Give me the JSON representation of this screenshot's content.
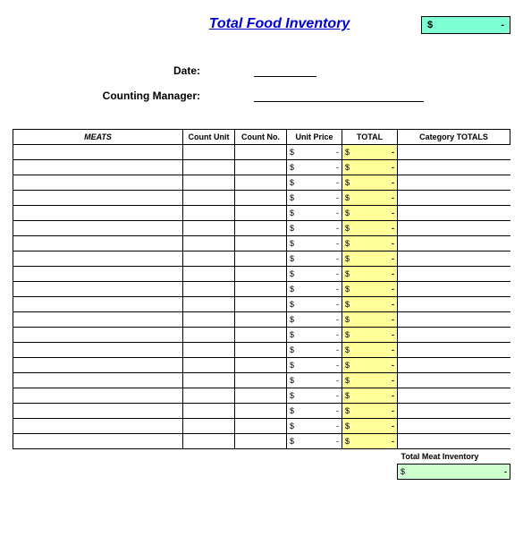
{
  "title": "Total Food Inventory",
  "grand_total": {
    "currency": "$",
    "value": "-"
  },
  "form": {
    "date_label": "Date:",
    "manager_label": "Counting Manager:"
  },
  "headers": {
    "category": "MEATS",
    "count_unit": "Count Unit",
    "count_no": "Count No.",
    "unit_price": "Unit Price",
    "total": "TOTAL",
    "cat_totals": "Category TOTALS"
  },
  "rows": [
    {
      "unit_price": {
        "c": "$",
        "v": "-"
      },
      "total": {
        "c": "$",
        "v": "-"
      }
    },
    {
      "unit_price": {
        "c": "$",
        "v": "-"
      },
      "total": {
        "c": "$",
        "v": "-"
      }
    },
    {
      "unit_price": {
        "c": "$",
        "v": "-"
      },
      "total": {
        "c": "$",
        "v": "-"
      }
    },
    {
      "unit_price": {
        "c": "$",
        "v": "-"
      },
      "total": {
        "c": "$",
        "v": "-"
      }
    },
    {
      "unit_price": {
        "c": "$",
        "v": "-"
      },
      "total": {
        "c": "$",
        "v": "-"
      }
    },
    {
      "unit_price": {
        "c": "$",
        "v": "-"
      },
      "total": {
        "c": "$",
        "v": "-"
      }
    },
    {
      "unit_price": {
        "c": "$",
        "v": "-"
      },
      "total": {
        "c": "$",
        "v": "-"
      }
    },
    {
      "unit_price": {
        "c": "$",
        "v": "-"
      },
      "total": {
        "c": "$",
        "v": "-"
      }
    },
    {
      "unit_price": {
        "c": "$",
        "v": "-"
      },
      "total": {
        "c": "$",
        "v": "-"
      }
    },
    {
      "unit_price": {
        "c": "$",
        "v": "-"
      },
      "total": {
        "c": "$",
        "v": "-"
      }
    },
    {
      "unit_price": {
        "c": "$",
        "v": "-"
      },
      "total": {
        "c": "$",
        "v": "-"
      }
    },
    {
      "unit_price": {
        "c": "$",
        "v": "-"
      },
      "total": {
        "c": "$",
        "v": "-"
      }
    },
    {
      "unit_price": {
        "c": "$",
        "v": "-"
      },
      "total": {
        "c": "$",
        "v": "-"
      }
    },
    {
      "unit_price": {
        "c": "$",
        "v": "-"
      },
      "total": {
        "c": "$",
        "v": "-"
      }
    },
    {
      "unit_price": {
        "c": "$",
        "v": "-"
      },
      "total": {
        "c": "$",
        "v": "-"
      }
    },
    {
      "unit_price": {
        "c": "$",
        "v": "-"
      },
      "total": {
        "c": "$",
        "v": "-"
      }
    },
    {
      "unit_price": {
        "c": "$",
        "v": "-"
      },
      "total": {
        "c": "$",
        "v": "-"
      }
    },
    {
      "unit_price": {
        "c": "$",
        "v": "-"
      },
      "total": {
        "c": "$",
        "v": "-"
      }
    },
    {
      "unit_price": {
        "c": "$",
        "v": "-"
      },
      "total": {
        "c": "$",
        "v": "-"
      }
    },
    {
      "unit_price": {
        "c": "$",
        "v": "-"
      },
      "total": {
        "c": "$",
        "v": "-"
      }
    }
  ],
  "footer": {
    "label": "Total Meat Inventory",
    "total": {
      "c": "$",
      "v": "-"
    }
  }
}
